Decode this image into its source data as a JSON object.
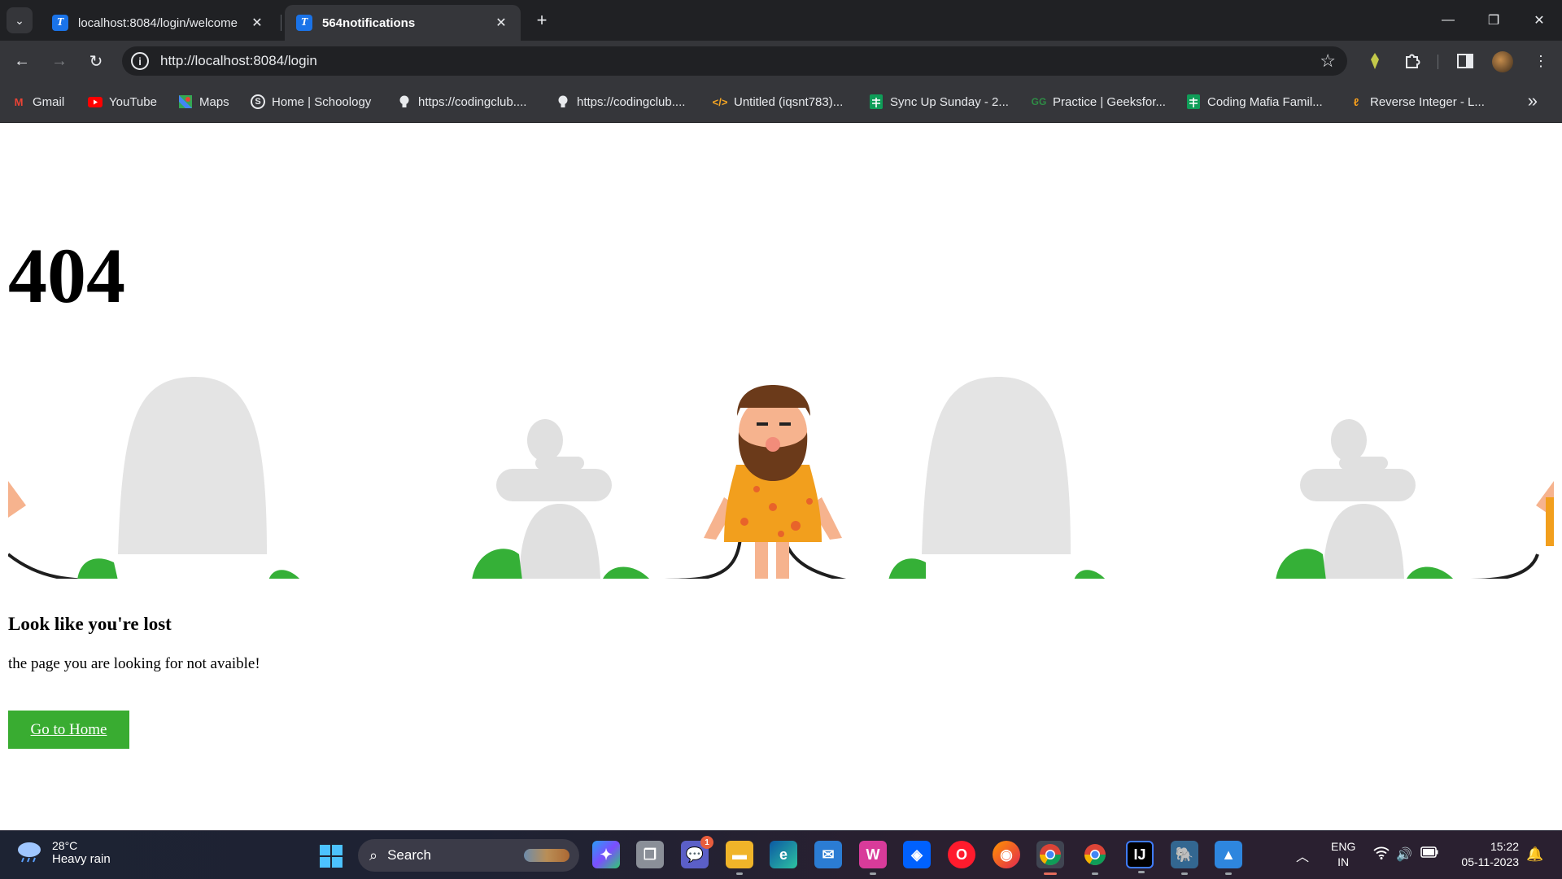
{
  "browser": {
    "tabs": [
      {
        "title": "localhost:8084/login/welcome",
        "favicon_letter": "T",
        "active": false
      },
      {
        "title": "564notifications",
        "favicon_letter": "T",
        "active": true
      }
    ],
    "url": "http://localhost:8084/login",
    "bookmarks": [
      {
        "label": "Gmail",
        "icon": "gmail-icon"
      },
      {
        "label": "YouTube",
        "icon": "youtube-icon"
      },
      {
        "label": "Maps",
        "icon": "maps-icon"
      },
      {
        "label": "Home | Schoology",
        "icon": "schoology-icon"
      },
      {
        "label": "https://codingclub....",
        "icon": "lightbulb-icon"
      },
      {
        "label": "https://codingclub....",
        "icon": "lightbulb-icon"
      },
      {
        "label": "Untitled (iqsnt783)...",
        "icon": "code-icon"
      },
      {
        "label": "Sync Up Sunday - 2...",
        "icon": "sheets-icon"
      },
      {
        "label": "Practice | Geeksfor...",
        "icon": "geeksforgeeks-icon"
      },
      {
        "label": "Coding Mafia Famil...",
        "icon": "sheets-icon"
      },
      {
        "label": "Reverse Integer - L...",
        "icon": "leetcode-icon"
      }
    ],
    "colors": {
      "tabstrip": "#202124",
      "toolbar": "#35363a"
    }
  },
  "page": {
    "code": "404",
    "heading": "Look like you're lost",
    "message": "the page you are looking for not avaible!",
    "button_label": "Go to Home",
    "button_color": "#39ac31"
  },
  "taskbar": {
    "weather_temp": "28°C",
    "weather_desc": "Heavy rain",
    "search_label": "Search",
    "teams_badge": "1",
    "lang_top": "ENG",
    "lang_bottom": "IN",
    "time": "15:22",
    "date": "05-11-2023"
  }
}
